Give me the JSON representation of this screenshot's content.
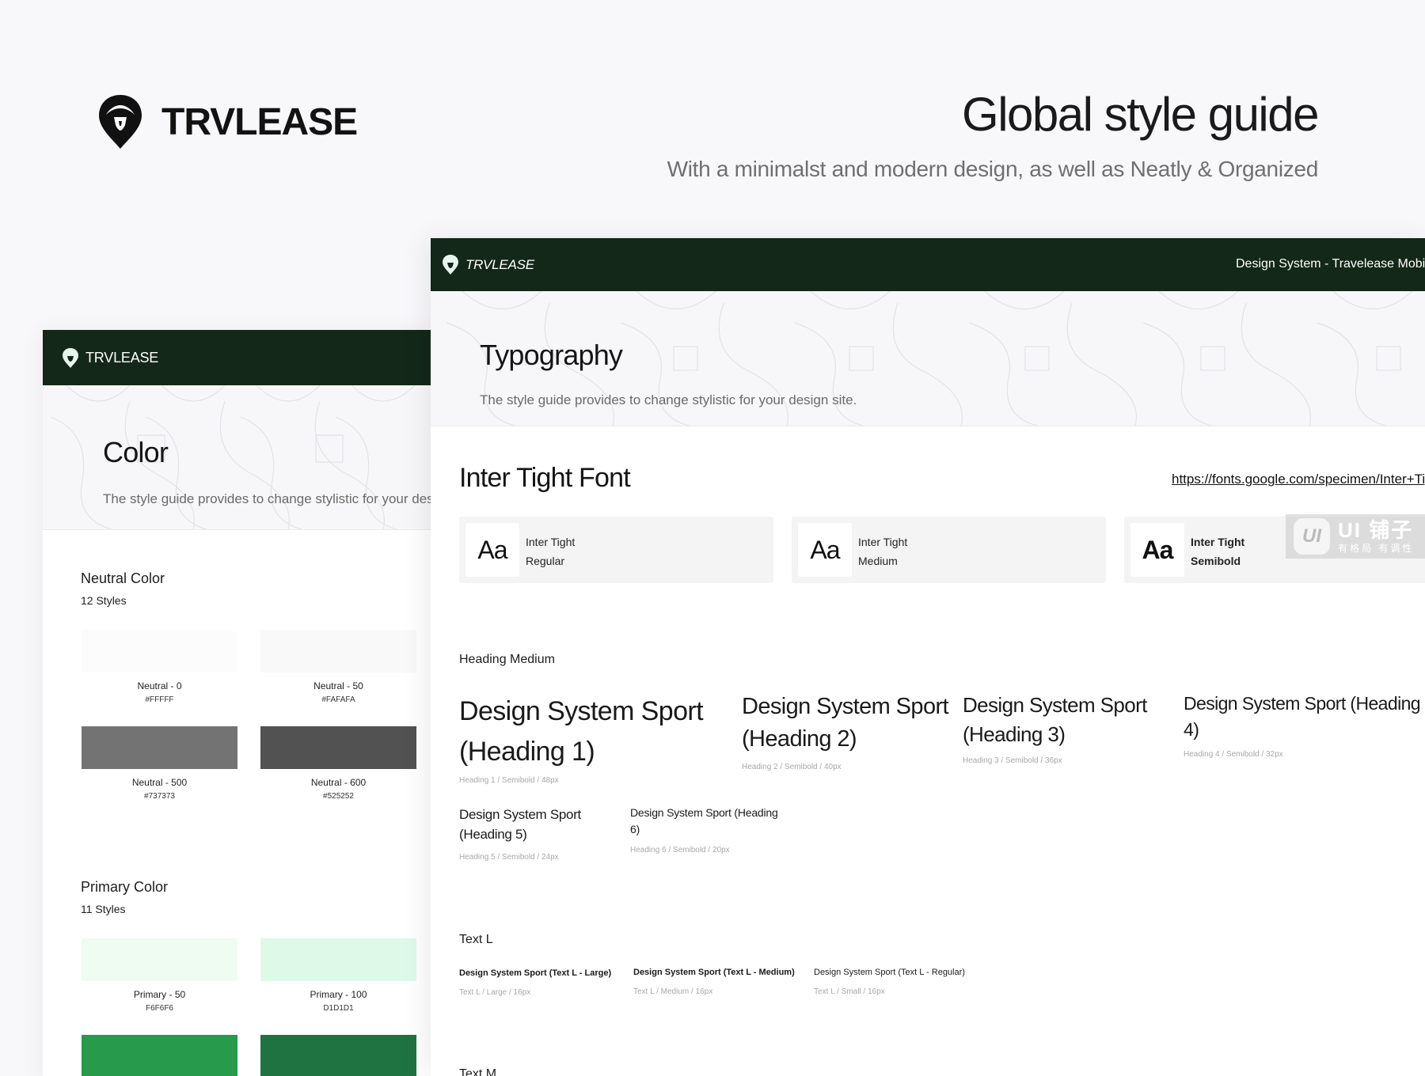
{
  "brand": {
    "name": "TRVLEASE"
  },
  "hero": {
    "title": "Global style guide",
    "subtitle": "With a minimalst and modern design, as well as Neatly & Organized"
  },
  "color_card": {
    "bar_brand": "TRVLEASE",
    "title": "Color",
    "description": "The style guide provides to change stylistic for your design site.",
    "neutral": {
      "title": "Neutral Color",
      "count": "12 Styles",
      "swatches": [
        {
          "name": "Neutral - 0",
          "hex": "#FFFFF",
          "color": "#fcfcfc"
        },
        {
          "name": "Neutral - 50",
          "hex": "#FAFAFA",
          "color": "#f9f9f9"
        },
        {
          "name": "Neutral - 500",
          "hex": "#737373",
          "color": "#737373"
        },
        {
          "name": "Neutral - 600",
          "hex": "#525252",
          "color": "#525252"
        }
      ]
    },
    "primary": {
      "title": "Primary Color",
      "count": "11 Styles",
      "swatches": [
        {
          "name": "Primary - 50",
          "hex": "F6F6F6",
          "color": "#eefcf2"
        },
        {
          "name": "Primary - 100",
          "hex": "D1D1D1",
          "color": "#dff9e8"
        },
        {
          "name": "",
          "hex": "",
          "color": "#279a4b"
        },
        {
          "name": "",
          "hex": "",
          "color": "#1f7340"
        }
      ]
    }
  },
  "typo_card": {
    "bar_brand": "TRVLEASE",
    "bar_right": "Design System - Travelease Mobile",
    "title": "Typography",
    "description": "The style guide provides to change stylistic for your design site.",
    "font_name": "Inter Tight Font",
    "font_link": "https://fonts.google.com/specimen/Inter+Tight",
    "weights": [
      {
        "aa": "Aa",
        "family": "Inter Tight",
        "weight": "Regular"
      },
      {
        "aa": "Aa",
        "family": "Inter Tight",
        "weight": "Medium"
      },
      {
        "aa": "Aa",
        "family": "Inter Tight",
        "weight": "Semibold"
      }
    ],
    "watermark": {
      "badge": "UI",
      "big": "UI 铺子",
      "small": "有格局 有调性"
    },
    "heading_medium": {
      "label": "Heading Medium",
      "items": [
        {
          "text": "Design System Sport (Heading 1)",
          "meta": "Heading 1 / Semibold / 48px"
        },
        {
          "text": "Design System Sport (Heading 2)",
          "meta": "Heading 2 / Semibold / 40px"
        },
        {
          "text": "Design System Sport (Heading 3)",
          "meta": "Heading 3 / Semibold / 36px"
        },
        {
          "text": "Design System Sport (Heading 4)",
          "meta": "Heading 4 / Semibold / 32px"
        },
        {
          "text": "Design System Sport (Heading 5)",
          "meta": "Heading 5 / Semibold / 24px"
        },
        {
          "text": "Design System Sport (Heading 6)",
          "meta": "Heading 6 / Semibold / 20px"
        }
      ]
    },
    "text_l": {
      "label": "Text L",
      "items": [
        {
          "text": "Design System Sport (Text L - Large)",
          "meta": "Text L  / Large / 16px"
        },
        {
          "text": "Design System Sport (Text L - Medium)",
          "meta": "Text L  / Medium / 16px"
        },
        {
          "text": "Design System Sport (Text L - Regular)",
          "meta": "Text L  / Small / 16px"
        }
      ]
    },
    "text_m": {
      "label": "Text M"
    }
  }
}
